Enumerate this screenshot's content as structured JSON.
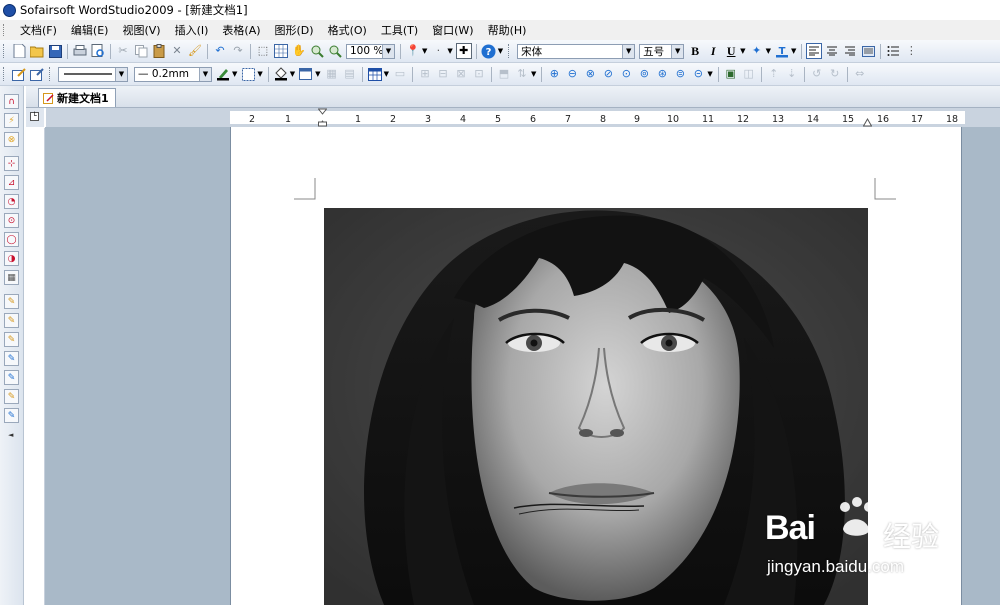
{
  "window": {
    "title": "Sofairsoft WordStudio2009 - [新建文档1]"
  },
  "menu": [
    "文档(F)",
    "编辑(E)",
    "视图(V)",
    "插入(I)",
    "表格(A)",
    "图形(D)",
    "格式(O)",
    "工具(T)",
    "窗口(W)",
    "帮助(H)"
  ],
  "toolbar1": {
    "zoom": "100 %",
    "font": "宋体",
    "font_size": "五号",
    "bold": "B",
    "italic": "I",
    "underline": "U"
  },
  "toolbar2": {
    "line_width": "0.2mm"
  },
  "tabs": [
    {
      "label": "新建文档1",
      "active": true
    }
  ],
  "ruler": {
    "ticks": [
      "2",
      "1",
      "1",
      "2",
      "3",
      "4",
      "5",
      "6",
      "7",
      "8",
      "9",
      "10",
      "11",
      "12",
      "13",
      "14",
      "15",
      "16",
      "17",
      "18"
    ]
  },
  "watermark": {
    "brand": "Bai",
    "brand_cn": "经验",
    "url": "jingyan.baidu.com"
  },
  "colors": {
    "toolbar_top": "#f7f9fc",
    "toolbar_bottom": "#dfe7f2",
    "workspace": "#a9b9c8",
    "accent_blue": "#1f6fd1"
  }
}
